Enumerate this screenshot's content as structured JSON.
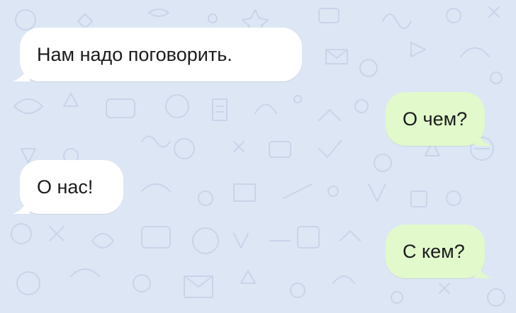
{
  "chat": {
    "background_color": "#dde6f4",
    "incoming_color": "#ffffff",
    "outgoing_color": "#e1f9cb",
    "messages": [
      {
        "direction": "incoming",
        "text": "Нам надо поговорить."
      },
      {
        "direction": "outgoing",
        "text": "О чем?"
      },
      {
        "direction": "incoming",
        "text": "О нас!"
      },
      {
        "direction": "outgoing",
        "text": "С кем?"
      }
    ]
  }
}
